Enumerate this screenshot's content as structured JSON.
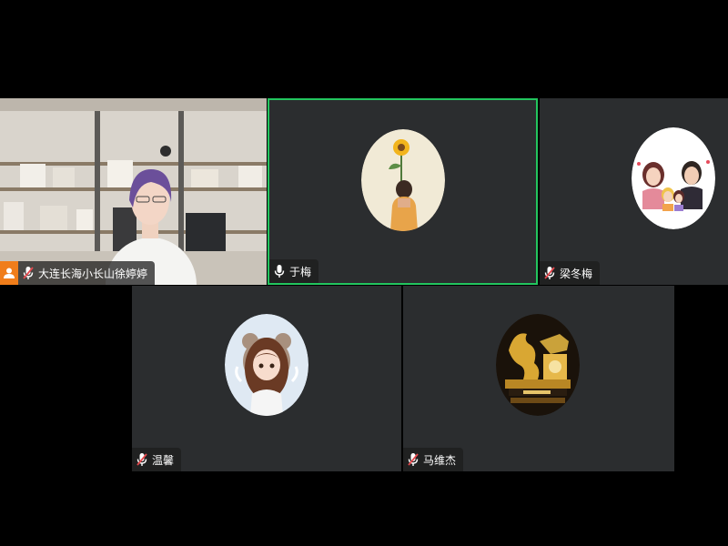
{
  "meeting": {
    "participants": [
      {
        "name": "大连长海小长山徐婷婷",
        "mic": "muted",
        "host": true,
        "video": true
      },
      {
        "name": "于梅",
        "mic": "on",
        "host": false,
        "video": false,
        "speaking": true
      },
      {
        "name": "梁冬梅",
        "mic": "muted",
        "host": false,
        "video": false
      },
      {
        "name": "温馨",
        "mic": "muted",
        "host": false,
        "video": false
      },
      {
        "name": "马维杰",
        "mic": "muted",
        "host": false,
        "video": false
      }
    ]
  },
  "colors": {
    "background": "#000000",
    "tile": "#2b2d2f",
    "active_speaker_border": "#22c55e",
    "host_badge": "#f07d1a",
    "mic_muted": "#e5484d"
  },
  "icons": {
    "host": "user-icon",
    "mic_on": "mic-icon",
    "mic_muted": "mic-muted-icon"
  }
}
